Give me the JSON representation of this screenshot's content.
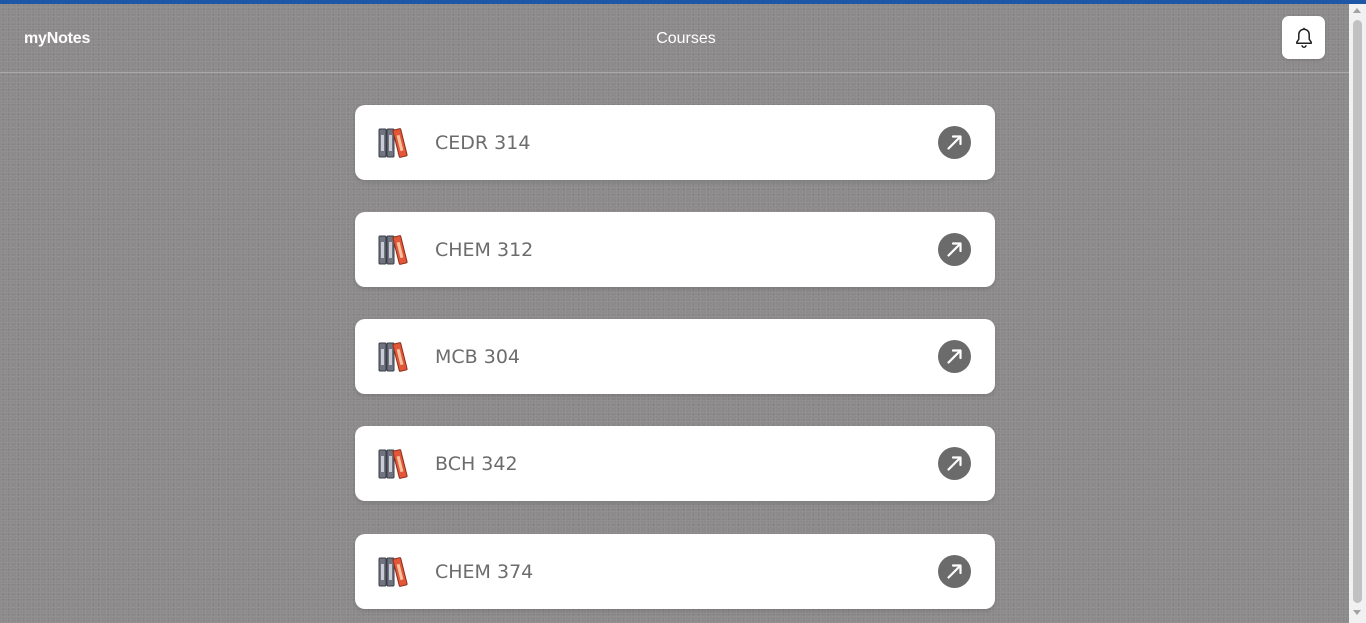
{
  "header": {
    "brand": "myNotes",
    "title": "Courses",
    "notification_icon": "bell-icon"
  },
  "courses": [
    {
      "name": "CEDR 314"
    },
    {
      "name": "CHEM 312"
    },
    {
      "name": "MCB 304"
    },
    {
      "name": "BCH 342"
    },
    {
      "name": "CHEM 374"
    }
  ],
  "icons": {
    "course": "books-icon",
    "open": "arrow-up-right-icon"
  },
  "colors": {
    "accent_bar": "#1e56a8",
    "background": "#8c8a8b",
    "card": "#ffffff",
    "course_text": "#6c6c6c",
    "open_button": "#6c6b6b",
    "book_gray": "#6f7480",
    "book_orange": "#e2573a"
  }
}
